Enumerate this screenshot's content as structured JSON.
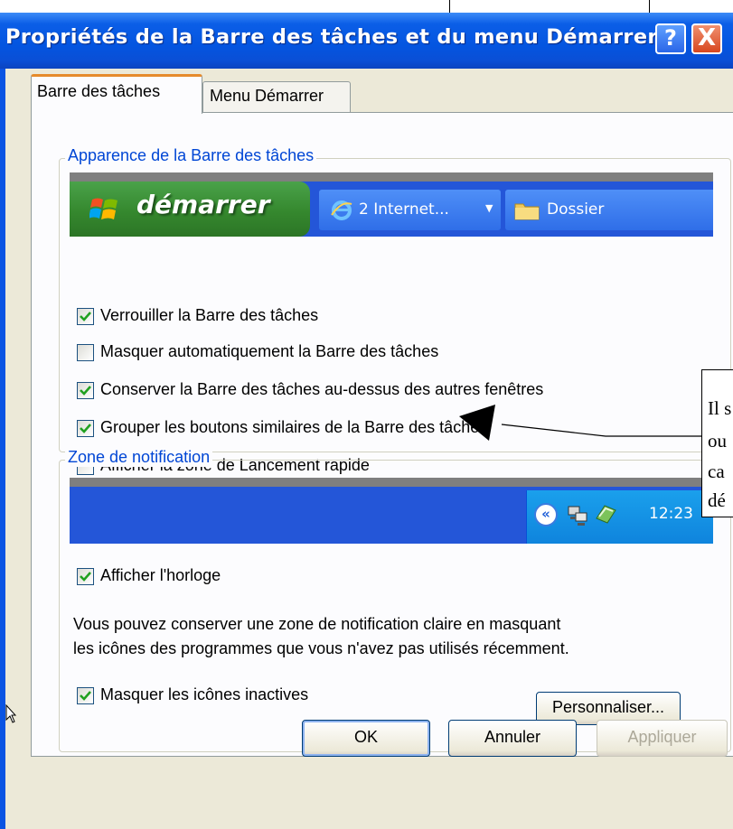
{
  "window": {
    "title": "Propriétés de la Barre des tâches et du menu Démarrer",
    "help_label": "?",
    "close_label": "X"
  },
  "tabs": [
    {
      "label": "Barre des tâches",
      "active": true
    },
    {
      "label": "Menu Démarrer",
      "active": false
    }
  ],
  "appearance": {
    "legend": "Apparence de la Barre des tâches",
    "preview": {
      "start_label": "démarrer",
      "task1_label": "2 Internet...",
      "task2_label": "Dossier"
    },
    "options": [
      {
        "label": "Verrouiller la Barre des tâches",
        "checked": true
      },
      {
        "label": "Masquer automatiquement la Barre des tâches",
        "checked": false
      },
      {
        "label": "Conserver la Barre des tâches au-dessus des autres fenêtres",
        "checked": true
      },
      {
        "label": "Grouper les boutons similaires de la Barre des tâches",
        "checked": true
      },
      {
        "label": "Afficher la zone de Lancement rapide",
        "checked": false
      }
    ]
  },
  "notification": {
    "legend": "Zone de notification",
    "clock_time": "12:23",
    "expand_label": "«",
    "show_clock": {
      "label": "Afficher l'horloge",
      "checked": true
    },
    "description_line1": "Vous pouvez conserver une zone de notification claire en masquant",
    "description_line2": "les icônes des programmes que vous n'avez pas utilisés récemment.",
    "hide_inactive": {
      "label": "Masquer les icônes inactives",
      "checked": true
    },
    "customize_label": "Personnaliser..."
  },
  "buttons": {
    "ok": "OK",
    "cancel": "Annuler",
    "apply": "Appliquer"
  },
  "callout": {
    "lines": [
      "Il s",
      "ou",
      "ca",
      "dé"
    ]
  },
  "colors": {
    "titlebar": "#0b5ee7",
    "dialog_bg": "#ece9d8",
    "legend_text": "#0046d5",
    "start_green": "#35882e",
    "taskbar_blue": "#2456d8",
    "tray_blue": "#1290e2",
    "checkmark_green": "#21a121",
    "tab_highlight": "#e68b2c"
  }
}
